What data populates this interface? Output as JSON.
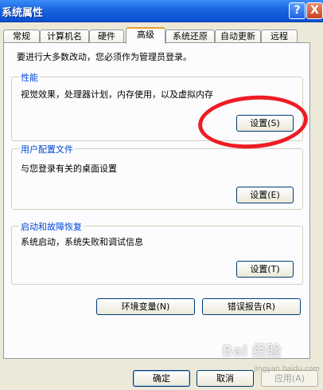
{
  "window": {
    "title": "系统属性",
    "help_glyph": "?",
    "close_glyph": "X"
  },
  "tabs": [
    {
      "label": "常规"
    },
    {
      "label": "计算机名"
    },
    {
      "label": "硬件"
    },
    {
      "label": "高级"
    },
    {
      "label": "系统还原"
    },
    {
      "label": "自动更新"
    },
    {
      "label": "远程"
    }
  ],
  "notice": "要进行大多数改动，您必须作为管理员登录。",
  "performance": {
    "label": "性能",
    "description": "视觉效果，处理器计划，内存使用，以及虚拟内存",
    "button": "设置(S)"
  },
  "user_profiles": {
    "label": "用户配置文件",
    "description": "与您登录有关的桌面设置",
    "button": "设置(E)"
  },
  "startup_recovery": {
    "label": "启动和故障恢复",
    "description": "系统启动，系统失败和调试信息",
    "button": "设置(T)"
  },
  "env_button": "环境变量(N)",
  "error_button": "错误报告(R)",
  "footer": {
    "ok": "确定",
    "cancel": "取消",
    "apply": "应用(A)"
  },
  "watermark": {
    "brand": "Bai 经验",
    "sub": "jingyan.baidu.com"
  }
}
